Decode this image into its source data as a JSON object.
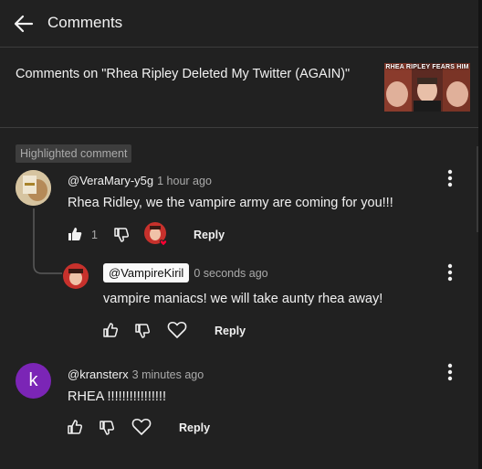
{
  "header": {
    "title": "Comments"
  },
  "video": {
    "title": "Comments on \"Rhea Ripley Deleted My Twitter (AGAIN)\"",
    "thumb_text": "RHEA RIPLEY FEARS HIM"
  },
  "highlight_badge": "Highlighted comment",
  "comments": [
    {
      "author": "@VeraMary-y5g",
      "time": "1 hour ago",
      "text": "Rhea Ridley, we the vampire army are coming for you!!!",
      "likes": "1",
      "reply_label": "Reply"
    },
    {
      "author": "@VampireKiril",
      "time": "0 seconds ago",
      "text": "vampire maniacs! we will take aunty rhea away!",
      "reply_label": "Reply"
    },
    {
      "author": "@kransterx",
      "time": "3 minutes ago",
      "text": "RHEA !!!!!!!!!!!!!!!!",
      "avatar_letter": "k",
      "reply_label": "Reply"
    }
  ],
  "colors": {
    "background": "#212121",
    "text_secondary": "#aaaaaa",
    "avatar_purple": "#7b25b6",
    "heart_red": "#ff0033"
  }
}
